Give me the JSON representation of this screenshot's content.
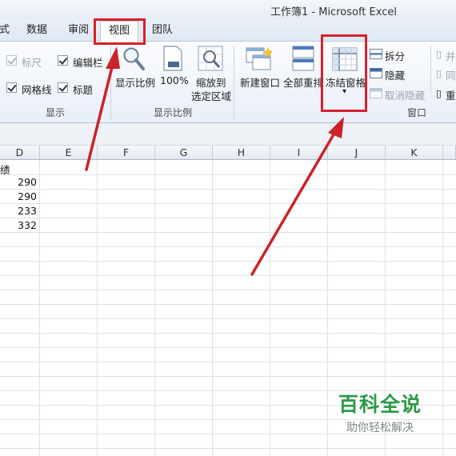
{
  "window": {
    "title": "工作簿1 - Microsoft Excel"
  },
  "tabs": [
    {
      "label": "式"
    },
    {
      "label": "数据"
    },
    {
      "label": "审阅"
    },
    {
      "label": "视图",
      "active": true
    },
    {
      "label": "团队"
    }
  ],
  "ribbon": {
    "show_group": {
      "label": "显示",
      "ruler": "标尺",
      "formula_bar": "编辑栏",
      "gridlines": "网格线",
      "headings": "标题"
    },
    "zoom_group": {
      "label": "显示比例",
      "zoom": "显示比例",
      "zoom100": "100%",
      "zoom_sel_1": "缩放到",
      "zoom_sel_2": "选定区域"
    },
    "window_group": {
      "label": "窗口",
      "new_window": "新建窗口",
      "arrange_all": "全部重排",
      "freeze_panes": "冻结窗格",
      "split": "拆分",
      "hide": "隐藏",
      "unhide": "取消隐藏",
      "partial_1": "并",
      "partial_2": "同",
      "partial_3": "重"
    }
  },
  "sheet": {
    "columns": [
      "D",
      "E",
      "F",
      "G",
      "H",
      "I",
      "J",
      "K"
    ],
    "header_cell": "绩",
    "values": [
      "290",
      "290",
      "233",
      "332"
    ]
  },
  "watermark": {
    "title": "百科全说",
    "subtitle": "助你轻松解决"
  },
  "colors": {
    "annotation": "#d8202a",
    "watermark": "#2c9a46"
  }
}
